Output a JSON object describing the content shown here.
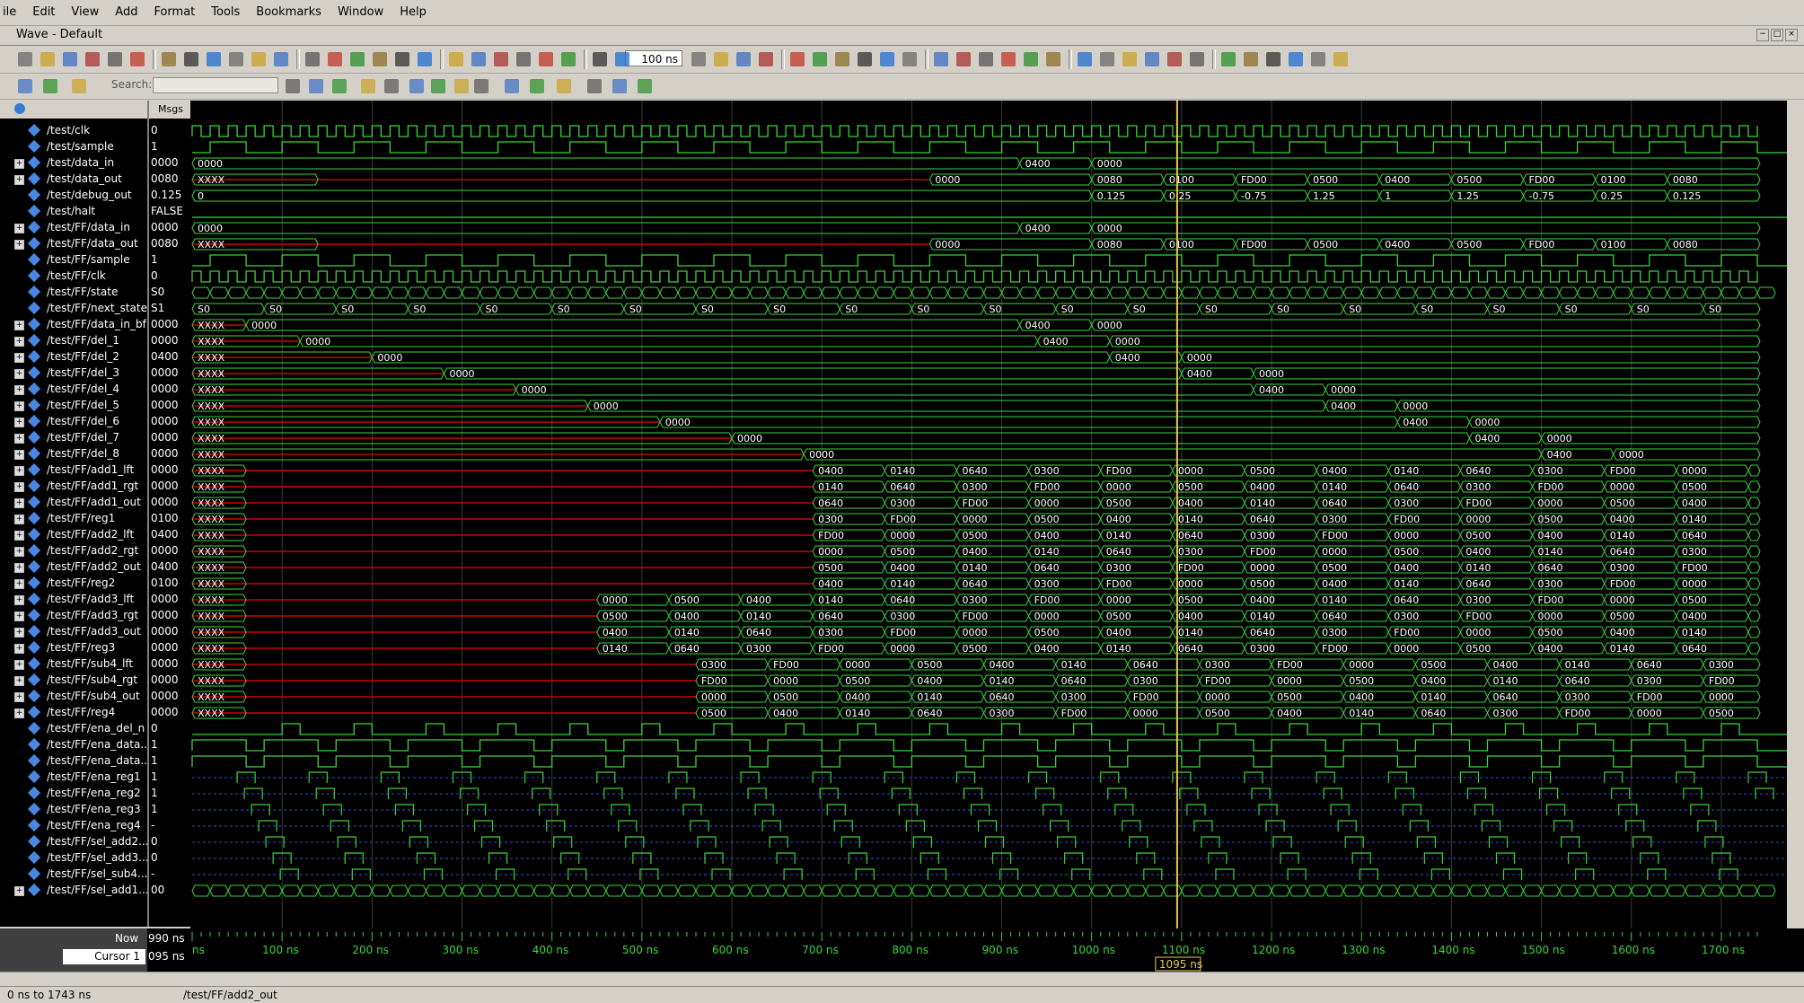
{
  "menu": [
    "ile",
    "Edit",
    "View",
    "Add",
    "Format",
    "Tools",
    "Bookmarks",
    "Window",
    "Help"
  ],
  "window_title": "Wave - Default",
  "toolbar": {
    "zoom_value": "100 ns",
    "search_label": "Search:"
  },
  "header": {
    "msgs_label": "Msgs"
  },
  "signals": [
    {
      "name": "/test/clk",
      "value": "0",
      "expandable": false
    },
    {
      "name": "/test/sample",
      "value": "1",
      "expandable": false
    },
    {
      "name": "/test/data_in",
      "value": "0000",
      "expandable": true
    },
    {
      "name": "/test/data_out",
      "value": "0080",
      "expandable": true
    },
    {
      "name": "/test/debug_out",
      "value": "0.125",
      "expandable": false
    },
    {
      "name": "/test/halt",
      "value": "FALSE",
      "expandable": false
    },
    {
      "name": "/test/FF/data_in",
      "value": "0000",
      "expandable": true
    },
    {
      "name": "/test/FF/data_out",
      "value": "0080",
      "expandable": true
    },
    {
      "name": "/test/FF/sample",
      "value": "1",
      "expandable": false
    },
    {
      "name": "/test/FF/clk",
      "value": "0",
      "expandable": false
    },
    {
      "name": "/test/FF/state",
      "value": "S0",
      "expandable": false
    },
    {
      "name": "/test/FF/next_state",
      "value": "S1",
      "expandable": false
    },
    {
      "name": "/test/FF/data_in_bf",
      "value": "0000",
      "expandable": true
    },
    {
      "name": "/test/FF/del_1",
      "value": "0000",
      "expandable": true
    },
    {
      "name": "/test/FF/del_2",
      "value": "0400",
      "expandable": true
    },
    {
      "name": "/test/FF/del_3",
      "value": "0000",
      "expandable": true
    },
    {
      "name": "/test/FF/del_4",
      "value": "0000",
      "expandable": true
    },
    {
      "name": "/test/FF/del_5",
      "value": "0000",
      "expandable": true
    },
    {
      "name": "/test/FF/del_6",
      "value": "0000",
      "expandable": true
    },
    {
      "name": "/test/FF/del_7",
      "value": "0000",
      "expandable": true
    },
    {
      "name": "/test/FF/del_8",
      "value": "0000",
      "expandable": true
    },
    {
      "name": "/test/FF/add1_lft",
      "value": "0000",
      "expandable": true
    },
    {
      "name": "/test/FF/add1_rgt",
      "value": "0000",
      "expandable": true
    },
    {
      "name": "/test/FF/add1_out",
      "value": "0000",
      "expandable": true
    },
    {
      "name": "/test/FF/reg1",
      "value": "0100",
      "expandable": true
    },
    {
      "name": "/test/FF/add2_lft",
      "value": "0400",
      "expandable": true
    },
    {
      "name": "/test/FF/add2_rgt",
      "value": "0000",
      "expandable": true
    },
    {
      "name": "/test/FF/add2_out",
      "value": "0400",
      "expandable": true
    },
    {
      "name": "/test/FF/reg2",
      "value": "0100",
      "expandable": true
    },
    {
      "name": "/test/FF/add3_lft",
      "value": "0000",
      "expandable": true
    },
    {
      "name": "/test/FF/add3_rgt",
      "value": "0000",
      "expandable": true
    },
    {
      "name": "/test/FF/add3_out",
      "value": "0000",
      "expandable": true
    },
    {
      "name": "/test/FF/reg3",
      "value": "0000",
      "expandable": true
    },
    {
      "name": "/test/FF/sub4_lft",
      "value": "0000",
      "expandable": true
    },
    {
      "name": "/test/FF/sub4_rgt",
      "value": "0000",
      "expandable": true
    },
    {
      "name": "/test/FF/sub4_out",
      "value": "0000",
      "expandable": true
    },
    {
      "name": "/test/FF/reg4",
      "value": "0000",
      "expandable": true
    },
    {
      "name": "/test/FF/ena_del_n",
      "value": "0",
      "expandable": false
    },
    {
      "name": "/test/FF/ena_data...",
      "value": "1",
      "expandable": false
    },
    {
      "name": "/test/FF/ena_data...",
      "value": "1",
      "expandable": false
    },
    {
      "name": "/test/FF/ena_reg1",
      "value": "1",
      "expandable": false
    },
    {
      "name": "/test/FF/ena_reg2",
      "value": "1",
      "expandable": false
    },
    {
      "name": "/test/FF/ena_reg3",
      "value": "1",
      "expandable": false
    },
    {
      "name": "/test/FF/ena_reg4",
      "value": "-",
      "expandable": false
    },
    {
      "name": "/test/FF/sel_add2...",
      "value": "0",
      "expandable": false
    },
    {
      "name": "/test/FF/sel_add3...",
      "value": "0",
      "expandable": false
    },
    {
      "name": "/test/FF/sel_sub4...",
      "value": "-",
      "expandable": false
    },
    {
      "name": "/test/FF/sel_add1...",
      "value": "00",
      "expandable": true
    }
  ],
  "waves": {
    "data_in_labels": [
      "0000",
      "0400",
      "0000"
    ],
    "data_out_labels": [
      "XXXX",
      "0000",
      "0080",
      "0100",
      "FD00",
      "0500",
      "0400",
      "0500",
      "FD00",
      "0100",
      "0080"
    ],
    "debug_out_labels": [
      "0",
      "0.125",
      "0.25",
      "-0.75",
      "1.25",
      "1",
      "1.25",
      "-0.75",
      "0.25",
      "0.125"
    ],
    "state_labels": [
      "S0",
      "S0",
      "S0",
      "S0",
      "S0",
      "S0",
      "S0",
      "S0",
      "S0",
      "S0",
      "S0",
      "S0",
      "S0",
      "S0",
      "S0",
      "S0",
      "S0",
      "S0",
      "S0",
      "S0",
      "S0",
      "S0"
    ],
    "del_labels": [
      "XXXX",
      "0000",
      "0400",
      "0000"
    ],
    "add_labels": [
      "XXXX",
      "0000",
      "0500",
      "0400",
      "0140",
      "0640",
      "0300",
      "FD00"
    ]
  },
  "timeline": {
    "ticks": [
      "ns",
      "100 ns",
      "200 ns",
      "300 ns",
      "400 ns",
      "500 ns",
      "600 ns",
      "700 ns",
      "800 ns",
      "900 ns",
      "1000 ns",
      "1100 ns",
      "1200 ns",
      "1300 ns",
      "1400 ns",
      "1500 ns",
      "1600 ns",
      "1700 ns"
    ],
    "now_label": "Now",
    "now_value": "990 ns",
    "cursor_label": "Cursor 1",
    "cursor_value": "095 ns",
    "cursor_marker": "1095 ns"
  },
  "status": {
    "range": "0 ns to 1743 ns",
    "selected": "/test/FF/add2_out"
  }
}
